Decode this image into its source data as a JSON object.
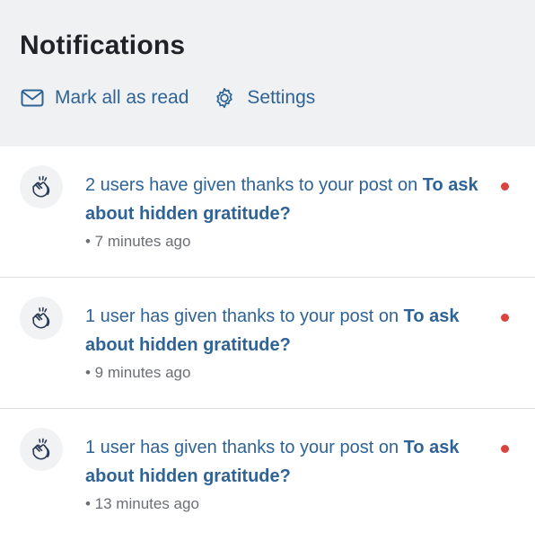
{
  "header": {
    "title": "Notifications",
    "mark_all_label": "Mark all as read",
    "settings_label": "Settings"
  },
  "notifications": [
    {
      "message": "2 users have given thanks to your post on",
      "post_title": "To ask about hidden gratitude?",
      "time": "• 7 minutes ago",
      "unread": true
    },
    {
      "message": "1 user has given thanks to your post on",
      "post_title": "To ask about hidden gratitude?",
      "time": "• 9 minutes ago",
      "unread": true
    },
    {
      "message": "1 user has given thanks to your post on",
      "post_title": "To ask about hidden gratitude?",
      "time": "• 13 minutes ago",
      "unread": true
    }
  ],
  "colors": {
    "accent": "#2f6395",
    "unread_dot": "#d9443f",
    "background": "#f0f1f3"
  },
  "icons": {
    "mark_all": "envelope-icon",
    "settings": "gear-icon",
    "notification": "clapping-hands-icon"
  }
}
